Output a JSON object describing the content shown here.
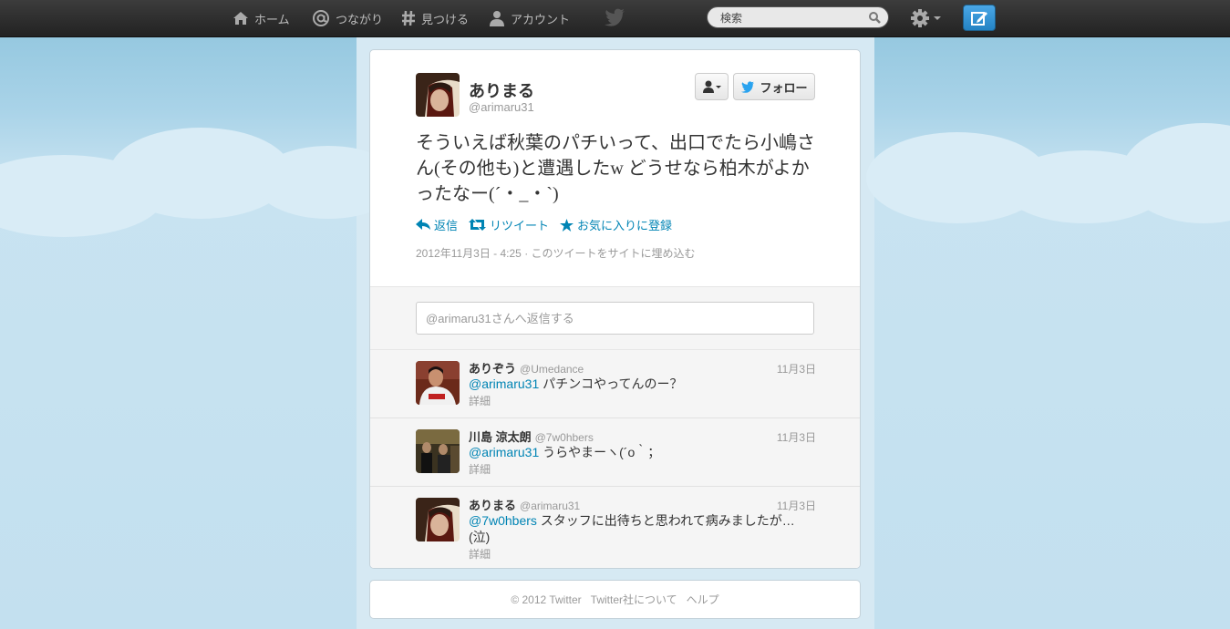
{
  "topbar": {
    "home_label": "ホーム",
    "connect_label": "つながり",
    "discover_label": "見つける",
    "account_label": "アカウント",
    "search_placeholder": "検索"
  },
  "tweet": {
    "name": "ありまる",
    "handle": "@arimaru31",
    "follow_label": "フォロー",
    "text": "そういえば秋葉のパチいって、出口でたら小嶋さん(その他も)と遭遇したw どうせなら柏木がよかったなー(´・_・`)",
    "actions": {
      "reply": "返信",
      "retweet": "リツイート",
      "favorite": "お気に入りに登録"
    },
    "timestamp": "2012年11月3日 - 4:25",
    "embed_label": "このツイートをサイトに埋め込む",
    "reply_placeholder": "@arimaru31さんへ返信する"
  },
  "replies": [
    {
      "name": "ありぞう",
      "handle": "@Umedance",
      "date": "11月3日",
      "mention": "@arimaru31",
      "text": " パチンコやってんのー？",
      "detail": "詳細"
    },
    {
      "name": "川島 涼太朗",
      "handle": "@7w0hbers",
      "date": "11月3日",
      "mention": "@arimaru31",
      "text": " うらやまーヽ(´o｀；",
      "detail": "詳細"
    },
    {
      "name": "ありまる",
      "handle": "@arimaru31",
      "date": "11月3日",
      "mention": "@7w0hbers",
      "text": " スタッフに出待ちと思われて病みましたが…(泣)",
      "detail": "詳細"
    }
  ],
  "footer": {
    "copyright": "© 2012 Twitter",
    "about": "Twitter社について",
    "help": "ヘルプ"
  },
  "colors": {
    "link": "#0084b4",
    "topbar": "#2b2b2b",
    "compose": "#2f8fd3"
  },
  "icons": [
    "home-icon",
    "at-icon",
    "hash-icon",
    "person-icon",
    "twitter-bird-icon",
    "search-icon",
    "gear-icon",
    "compose-icon",
    "user-dropdown-icon",
    "reply-icon",
    "retweet-icon",
    "star-icon"
  ]
}
